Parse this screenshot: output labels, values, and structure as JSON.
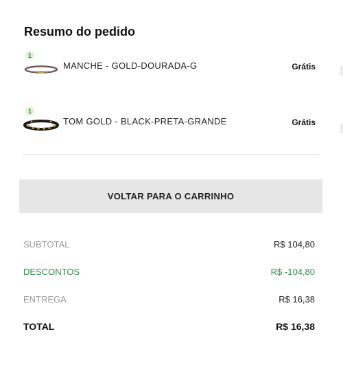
{
  "summary": {
    "title": "Resumo do pedido"
  },
  "items": [
    {
      "qty": "1",
      "name": "MANCHE - GOLD-DOURADA-G",
      "price": "Grátis"
    },
    {
      "qty": "1",
      "name": "TOM GOLD - BLACK-PRETA-GRANDE",
      "price": "Grátis"
    }
  ],
  "actions": {
    "back_to_cart": "VOLTAR PARA O CARRINHO"
  },
  "totals": {
    "subtotal_label": "SUBTOTAL",
    "subtotal_value": "R$ 104,80",
    "discounts_label": "DESCONTOS",
    "discounts_value": "R$ -104,80",
    "shipping_label": "ENTREGA",
    "shipping_value": "R$ 16,38",
    "total_label": "TOTAL",
    "total_value": "R$ 16,38"
  },
  "colors": {
    "discount": "#2f8a4f",
    "qty_badge_bg": "#dff3d8",
    "button_bg": "#e6e6e6"
  }
}
